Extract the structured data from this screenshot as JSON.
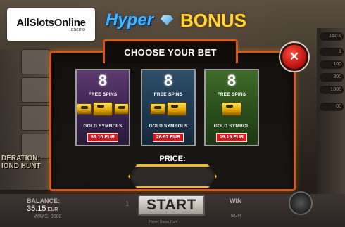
{
  "brand": {
    "logo_text": "AllSlotsOnline",
    "logo_sub": ".casino"
  },
  "title": {
    "hyper": "Hyper",
    "bonus": "BONUS"
  },
  "modal": {
    "header": "CHOOSE YOUR BET",
    "close_label": "✕",
    "price_label": "PRICE:",
    "price_value": ""
  },
  "cards": [
    {
      "count": "8",
      "spins": "FREE SPINS",
      "symbols": "GOLD SYMBOLS",
      "price": "56.10 EUR",
      "color": "#5e3a70"
    },
    {
      "count": "8",
      "spins": "FREE SPINS",
      "symbols": "GOLD SYMBOLS",
      "price": "26.97 EUR",
      "color": "#2e4f6a"
    },
    {
      "count": "8",
      "spins": "FREE SPINS",
      "symbols": "GOLD SYMBOL",
      "price": "19.19 EUR",
      "color": "#3f6b2a"
    }
  ],
  "bottom": {
    "balance_label": "BALANCE:",
    "balance_value": "35.15",
    "balance_unit": "EUR",
    "ways_label": "WAYS: 3888",
    "start_label": "START",
    "win_label": "WIN",
    "win_unit": "EUR",
    "bet_ghost": "1",
    "caption": "Hyper Game Hunt"
  },
  "left_logo": {
    "line1": "DERATION:",
    "line2": "IOND HUNT"
  },
  "right_panel": {
    "rows": [
      "JACK",
      "1",
      "100",
      "300",
      "1000",
      "00"
    ]
  },
  "colors": {
    "modal_border": "#d45a16",
    "price_button": "#d5171b",
    "title_hyper": "#3fb5ff",
    "title_bonus": "#ffd53a"
  }
}
